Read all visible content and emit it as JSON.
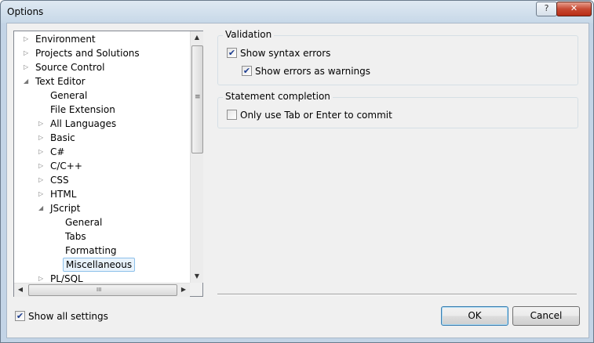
{
  "window": {
    "title": "Options"
  },
  "titlebar": {
    "help_symbol": "?",
    "close_symbol": "✕"
  },
  "tree": {
    "items": [
      {
        "label": "Environment",
        "arrow": "▷"
      },
      {
        "label": "Projects and Solutions",
        "arrow": "▷"
      },
      {
        "label": "Source Control",
        "arrow": "▷"
      },
      {
        "label": "Text Editor",
        "arrow": "◢"
      },
      {
        "label": "General",
        "arrow": ""
      },
      {
        "label": "File Extension",
        "arrow": ""
      },
      {
        "label": "All Languages",
        "arrow": "▷"
      },
      {
        "label": "Basic",
        "arrow": "▷"
      },
      {
        "label": "C#",
        "arrow": "▷"
      },
      {
        "label": "C/C++",
        "arrow": "▷"
      },
      {
        "label": "CSS",
        "arrow": "▷"
      },
      {
        "label": "HTML",
        "arrow": "▷"
      },
      {
        "label": "JScript",
        "arrow": "◢"
      },
      {
        "label": "General",
        "arrow": ""
      },
      {
        "label": "Tabs",
        "arrow": ""
      },
      {
        "label": "Formatting",
        "arrow": ""
      },
      {
        "label": "Miscellaneous",
        "arrow": "",
        "selected": true
      },
      {
        "label": "PL/SQL",
        "arrow": "▷"
      }
    ],
    "scrollbar": {
      "up": "▲",
      "down": "▼",
      "left": "◀",
      "right": "▶",
      "v_grip": "≡",
      "h_grip": "III"
    }
  },
  "validation": {
    "title": "Validation",
    "show_syntax_errors": {
      "label": "Show syntax errors",
      "checked": true
    },
    "show_errors_as_warnings": {
      "label": "Show errors as warnings",
      "checked": true
    }
  },
  "statement_completion": {
    "title": "Statement completion",
    "only_tab_enter": {
      "label": "Only use Tab or Enter to commit",
      "checked": false
    }
  },
  "footer": {
    "show_all_settings": {
      "label": "Show all settings",
      "checked": true
    },
    "ok_label": "OK",
    "cancel_label": "Cancel"
  },
  "check_mark": "✔",
  "colors": {
    "selection_bg": "#e9f3fc",
    "selection_border": "#8cc0ea"
  }
}
